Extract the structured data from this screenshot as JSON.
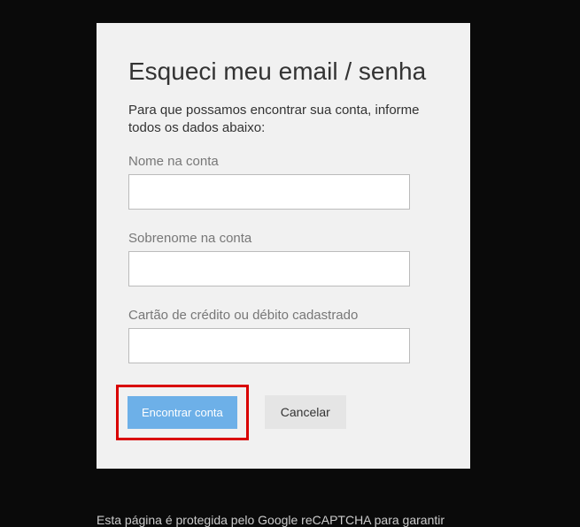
{
  "card": {
    "title": "Esqueci meu email / senha",
    "description": "Para que possamos encontrar sua conta, informe todos os dados abaixo:",
    "fields": {
      "first_name": {
        "label": "Nome na conta",
        "value": ""
      },
      "last_name": {
        "label": "Sobrenome na conta",
        "value": ""
      },
      "card_number": {
        "label": "Cartão de crédito ou débito cadastrado",
        "value": ""
      }
    },
    "buttons": {
      "submit": "Encontrar conta",
      "cancel": "Cancelar"
    }
  },
  "footer": "Esta página é protegida pelo Google reCAPTCHA para garantir"
}
